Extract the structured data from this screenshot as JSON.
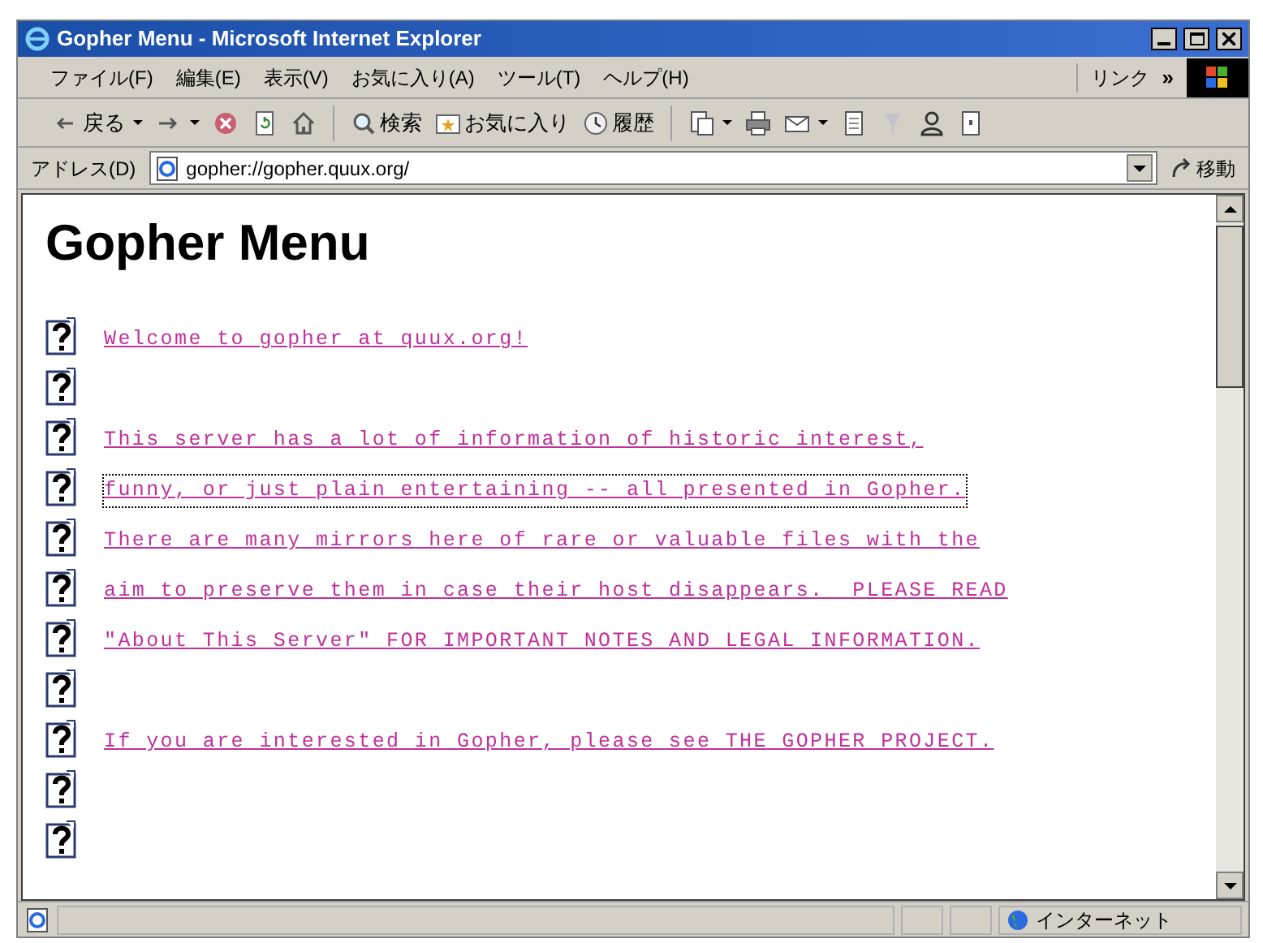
{
  "window": {
    "title": "Gopher Menu - Microsoft Internet Explorer"
  },
  "menu": [
    "ファイル(F)",
    "編集(E)",
    "表示(V)",
    "お気に入り(A)",
    "ツール(T)",
    "ヘルプ(H)"
  ],
  "links": {
    "label": "リンク",
    "more": "»"
  },
  "toolbar": [
    {
      "kind": "back",
      "label": "戻る",
      "dropdown": true
    },
    {
      "kind": "forward",
      "dropdown": true
    },
    {
      "kind": "stop"
    },
    {
      "kind": "refresh"
    },
    {
      "kind": "home"
    },
    {
      "kind": "search",
      "label": "検索"
    },
    {
      "kind": "favorites",
      "label": "お気に入り"
    },
    {
      "kind": "history",
      "label": "履歴"
    },
    {
      "kind": "print-preview",
      "dropdown": true
    },
    {
      "kind": "print"
    },
    {
      "kind": "mail",
      "dropdown": true
    },
    {
      "kind": "edit"
    },
    {
      "kind": "discuss",
      "disabled": true
    },
    {
      "kind": "messenger"
    },
    {
      "kind": "research"
    }
  ],
  "address": {
    "label": "アドレス(D)",
    "value": "gopher://gopher.quux.org/",
    "go": "移動"
  },
  "page": {
    "heading": "Gopher Menu",
    "rows": [
      {
        "text": "Welcome to gopher at quux.org!",
        "focused": false
      },
      {},
      {
        "text": "This server has a lot of information of historic interest,",
        "focused": false
      },
      {
        "text": "funny, or just plain entertaining -- all presented in Gopher.",
        "focused": true
      },
      {
        "text": "There are many mirrors here of rare or valuable files with the",
        "focused": false
      },
      {
        "text": "aim to preserve them in case their host disappears.  PLEASE READ",
        "focused": false
      },
      {
        "text": "\"About This Server\" FOR IMPORTANT NOTES AND LEGAL INFORMATION.",
        "focused": false
      },
      {},
      {
        "text": "If you are interested in Gopher, please see THE GOPHER PROJECT.",
        "focused": false
      },
      {},
      {}
    ]
  },
  "status_bar": {
    "zone": "インターネット"
  }
}
